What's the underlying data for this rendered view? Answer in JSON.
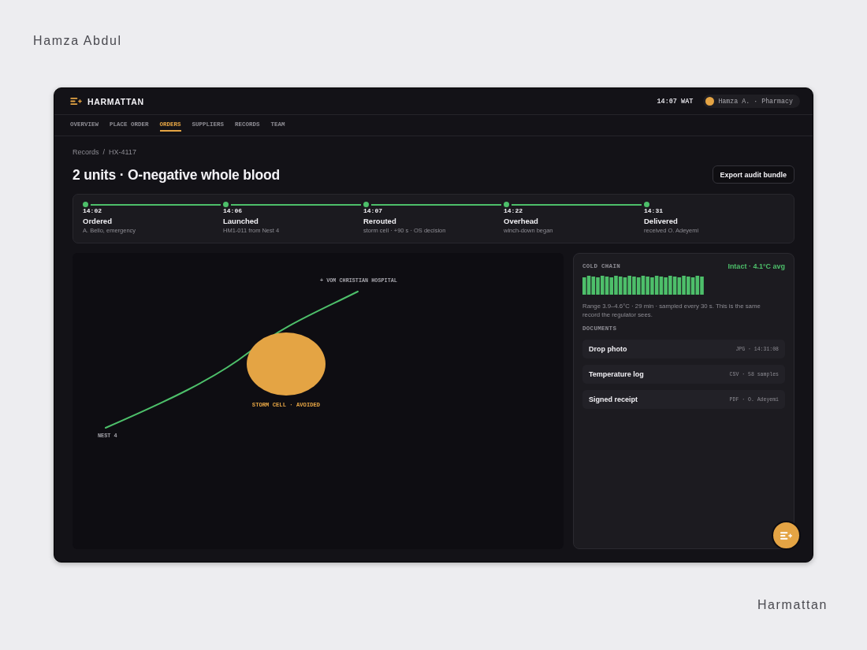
{
  "author": "Hamza Abdul",
  "header": {
    "brand": "HARMATTAN",
    "clock": "14:07 WAT",
    "user": "Hamza A. · Pharmacy"
  },
  "nav": [
    {
      "label": "OVERVIEW",
      "selected": false
    },
    {
      "label": "PLACE ORDER",
      "selected": false
    },
    {
      "label": "ORDERS",
      "selected": true
    },
    {
      "label": "SUPPLIERS",
      "selected": false
    },
    {
      "label": "RECORDS",
      "selected": false
    },
    {
      "label": "TEAM",
      "selected": false
    }
  ],
  "breadcrumb": {
    "items": [
      "Records",
      "HX-4117"
    ],
    "separator": "/"
  },
  "title": "2 units · O-negative whole blood",
  "export_button": "Export audit bundle",
  "timeline": [
    {
      "time": "14:02",
      "label": "Ordered",
      "detail": "A. Bello, emergency",
      "done": true
    },
    {
      "time": "14:06",
      "label": "Launched",
      "detail": "HM1-011 from Nest 4",
      "done": true
    },
    {
      "time": "14:07",
      "label": "Rerouted",
      "detail": "storm cell · +90 s · OS decision",
      "done": true
    },
    {
      "time": "14:22",
      "label": "Overhead",
      "detail": "winch-down began",
      "done": true
    },
    {
      "time": "14:31",
      "label": "Delivered",
      "detail": "received O. Adeyemi",
      "done": true
    }
  ],
  "map": {
    "destination": "+ VOM CHRISTIAN HOSPITAL",
    "hazard": "STORM CELL · AVOIDED",
    "origin": "NEST 4"
  },
  "cold_chain": {
    "label": "COLD CHAIN",
    "status": "Intact · 4.1°C avg",
    "note": "Range 3.9–4.6°C · 29 min · sampled every 30 s. This is the same record the regulator sees."
  },
  "documents": {
    "label": "DOCUMENTS",
    "items": [
      {
        "name": "Drop photo",
        "meta": "JPG · 14:31:08"
      },
      {
        "name": "Temperature log",
        "meta": "CSV · 58 samples"
      },
      {
        "name": "Signed receipt",
        "meta": "PDF · O. Adeyemi"
      }
    ]
  },
  "project": "Harmattan"
}
